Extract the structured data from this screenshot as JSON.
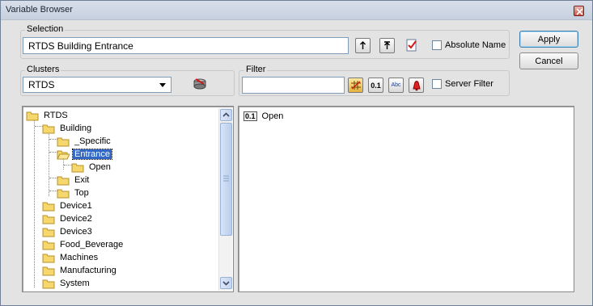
{
  "window": {
    "title": "Variable Browser"
  },
  "selection": {
    "legend": "Selection",
    "value": "RTDS Building Entrance",
    "absolute_name_label": "Absolute Name"
  },
  "buttons": {
    "apply": "Apply",
    "cancel": "Cancel"
  },
  "clusters": {
    "legend": "Clusters",
    "selected": "RTDS"
  },
  "filter": {
    "legend": "Filter",
    "value": "",
    "type01_label": "0.1",
    "type_abc_label": "Abc",
    "server_filter_label": "Server Filter"
  },
  "tree": {
    "items": [
      {
        "label": "RTDS"
      },
      {
        "label": "Building"
      },
      {
        "label": "_Specific"
      },
      {
        "label": "Entrance",
        "selected": true
      },
      {
        "label": "Open"
      },
      {
        "label": "Exit"
      },
      {
        "label": "Top"
      },
      {
        "label": "Device1"
      },
      {
        "label": "Device2"
      },
      {
        "label": "Device3"
      },
      {
        "label": "Food_Beverage"
      },
      {
        "label": "Machines"
      },
      {
        "label": "Manufacturing"
      },
      {
        "label": "System"
      }
    ]
  },
  "variables": {
    "items": [
      {
        "type_badge": "0.1",
        "label": "Open"
      }
    ]
  },
  "colors": {
    "selection_highlight": "#3168c6",
    "folder": "#f5d76e"
  }
}
